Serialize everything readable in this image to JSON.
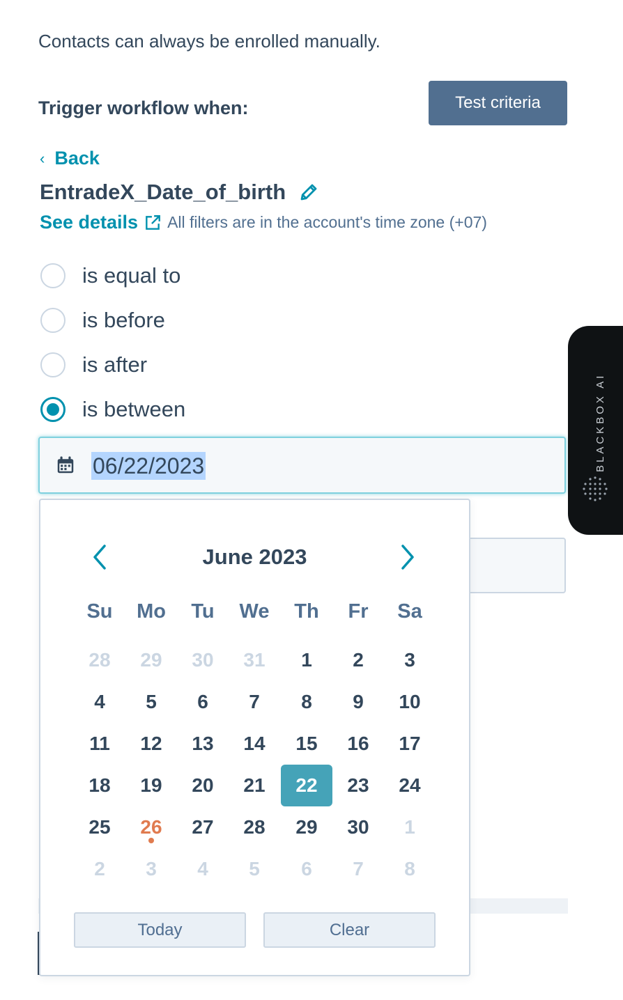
{
  "intro_text": "Contacts can always be enrolled manually.",
  "trigger_label": "Trigger workflow when:",
  "test_button": "Test criteria",
  "back_link": "Back",
  "property_name": "EntradeX_Date_of_birth",
  "see_details": "See details",
  "timezone_note": "All filters are in the account's time zone (+07)",
  "operators": [
    {
      "label": "is equal to",
      "checked": false
    },
    {
      "label": "is before",
      "checked": false
    },
    {
      "label": "is after",
      "checked": false
    },
    {
      "label": "is between",
      "checked": true
    }
  ],
  "date_value": "06/22/2023",
  "calendar": {
    "month_label": "June 2023",
    "weekdays": [
      "Su",
      "Mo",
      "Tu",
      "We",
      "Th",
      "Fr",
      "Sa"
    ],
    "weeks": [
      [
        "28",
        "29",
        "30",
        "31",
        "1",
        "2",
        "3"
      ],
      [
        "4",
        "5",
        "6",
        "7",
        "8",
        "9",
        "10"
      ],
      [
        "11",
        "12",
        "13",
        "14",
        "15",
        "16",
        "17"
      ],
      [
        "18",
        "19",
        "20",
        "21",
        "22",
        "23",
        "24"
      ],
      [
        "25",
        "26",
        "27",
        "28",
        "29",
        "30",
        "1"
      ],
      [
        "2",
        "3",
        "4",
        "5",
        "6",
        "7",
        "8"
      ]
    ],
    "selected_day": "22",
    "today_day": "26",
    "today_button": "Today",
    "clear_button": "Clear"
  },
  "side_tab": {
    "label": "BLACKBOX AI"
  },
  "colors": {
    "accent": "#0091ae",
    "selected": "#45a3b8",
    "today": "#e07b4f",
    "button_dark": "#516f90"
  }
}
